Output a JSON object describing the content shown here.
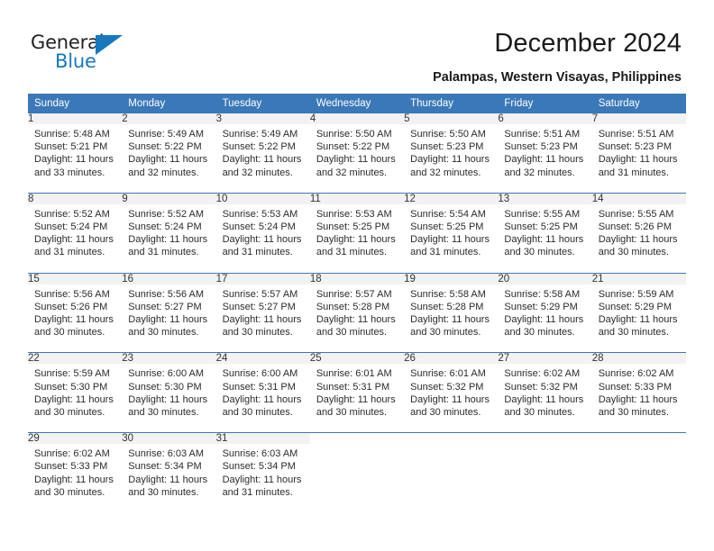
{
  "brand": {
    "name_part1": "General",
    "name_part2": "Blue",
    "accent_color": "#1878be"
  },
  "header": {
    "title": "December 2024",
    "location": "Palampas, Western Visayas, Philippines"
  },
  "theme": {
    "header_blue": "#3b78b8",
    "daynum_background": "#f2f2f2",
    "text_color": "#2b2b2b"
  },
  "weekday_headers": [
    "Sunday",
    "Monday",
    "Tuesday",
    "Wednesday",
    "Thursday",
    "Friday",
    "Saturday"
  ],
  "weeks": [
    {
      "days": [
        {
          "num": "1",
          "sunrise": "Sunrise: 5:48 AM",
          "sunset": "Sunset: 5:21 PM",
          "daylight1": "Daylight: 11 hours",
          "daylight2": "and 33 minutes."
        },
        {
          "num": "2",
          "sunrise": "Sunrise: 5:49 AM",
          "sunset": "Sunset: 5:22 PM",
          "daylight1": "Daylight: 11 hours",
          "daylight2": "and 32 minutes."
        },
        {
          "num": "3",
          "sunrise": "Sunrise: 5:49 AM",
          "sunset": "Sunset: 5:22 PM",
          "daylight1": "Daylight: 11 hours",
          "daylight2": "and 32 minutes."
        },
        {
          "num": "4",
          "sunrise": "Sunrise: 5:50 AM",
          "sunset": "Sunset: 5:22 PM",
          "daylight1": "Daylight: 11 hours",
          "daylight2": "and 32 minutes."
        },
        {
          "num": "5",
          "sunrise": "Sunrise: 5:50 AM",
          "sunset": "Sunset: 5:23 PM",
          "daylight1": "Daylight: 11 hours",
          "daylight2": "and 32 minutes."
        },
        {
          "num": "6",
          "sunrise": "Sunrise: 5:51 AM",
          "sunset": "Sunset: 5:23 PM",
          "daylight1": "Daylight: 11 hours",
          "daylight2": "and 32 minutes."
        },
        {
          "num": "7",
          "sunrise": "Sunrise: 5:51 AM",
          "sunset": "Sunset: 5:23 PM",
          "daylight1": "Daylight: 11 hours",
          "daylight2": "and 31 minutes."
        }
      ]
    },
    {
      "days": [
        {
          "num": "8",
          "sunrise": "Sunrise: 5:52 AM",
          "sunset": "Sunset: 5:24 PM",
          "daylight1": "Daylight: 11 hours",
          "daylight2": "and 31 minutes."
        },
        {
          "num": "9",
          "sunrise": "Sunrise: 5:52 AM",
          "sunset": "Sunset: 5:24 PM",
          "daylight1": "Daylight: 11 hours",
          "daylight2": "and 31 minutes."
        },
        {
          "num": "10",
          "sunrise": "Sunrise: 5:53 AM",
          "sunset": "Sunset: 5:24 PM",
          "daylight1": "Daylight: 11 hours",
          "daylight2": "and 31 minutes."
        },
        {
          "num": "11",
          "sunrise": "Sunrise: 5:53 AM",
          "sunset": "Sunset: 5:25 PM",
          "daylight1": "Daylight: 11 hours",
          "daylight2": "and 31 minutes."
        },
        {
          "num": "12",
          "sunrise": "Sunrise: 5:54 AM",
          "sunset": "Sunset: 5:25 PM",
          "daylight1": "Daylight: 11 hours",
          "daylight2": "and 31 minutes."
        },
        {
          "num": "13",
          "sunrise": "Sunrise: 5:55 AM",
          "sunset": "Sunset: 5:25 PM",
          "daylight1": "Daylight: 11 hours",
          "daylight2": "and 30 minutes."
        },
        {
          "num": "14",
          "sunrise": "Sunrise: 5:55 AM",
          "sunset": "Sunset: 5:26 PM",
          "daylight1": "Daylight: 11 hours",
          "daylight2": "and 30 minutes."
        }
      ]
    },
    {
      "days": [
        {
          "num": "15",
          "sunrise": "Sunrise: 5:56 AM",
          "sunset": "Sunset: 5:26 PM",
          "daylight1": "Daylight: 11 hours",
          "daylight2": "and 30 minutes."
        },
        {
          "num": "16",
          "sunrise": "Sunrise: 5:56 AM",
          "sunset": "Sunset: 5:27 PM",
          "daylight1": "Daylight: 11 hours",
          "daylight2": "and 30 minutes."
        },
        {
          "num": "17",
          "sunrise": "Sunrise: 5:57 AM",
          "sunset": "Sunset: 5:27 PM",
          "daylight1": "Daylight: 11 hours",
          "daylight2": "and 30 minutes."
        },
        {
          "num": "18",
          "sunrise": "Sunrise: 5:57 AM",
          "sunset": "Sunset: 5:28 PM",
          "daylight1": "Daylight: 11 hours",
          "daylight2": "and 30 minutes."
        },
        {
          "num": "19",
          "sunrise": "Sunrise: 5:58 AM",
          "sunset": "Sunset: 5:28 PM",
          "daylight1": "Daylight: 11 hours",
          "daylight2": "and 30 minutes."
        },
        {
          "num": "20",
          "sunrise": "Sunrise: 5:58 AM",
          "sunset": "Sunset: 5:29 PM",
          "daylight1": "Daylight: 11 hours",
          "daylight2": "and 30 minutes."
        },
        {
          "num": "21",
          "sunrise": "Sunrise: 5:59 AM",
          "sunset": "Sunset: 5:29 PM",
          "daylight1": "Daylight: 11 hours",
          "daylight2": "and 30 minutes."
        }
      ]
    },
    {
      "days": [
        {
          "num": "22",
          "sunrise": "Sunrise: 5:59 AM",
          "sunset": "Sunset: 5:30 PM",
          "daylight1": "Daylight: 11 hours",
          "daylight2": "and 30 minutes."
        },
        {
          "num": "23",
          "sunrise": "Sunrise: 6:00 AM",
          "sunset": "Sunset: 5:30 PM",
          "daylight1": "Daylight: 11 hours",
          "daylight2": "and 30 minutes."
        },
        {
          "num": "24",
          "sunrise": "Sunrise: 6:00 AM",
          "sunset": "Sunset: 5:31 PM",
          "daylight1": "Daylight: 11 hours",
          "daylight2": "and 30 minutes."
        },
        {
          "num": "25",
          "sunrise": "Sunrise: 6:01 AM",
          "sunset": "Sunset: 5:31 PM",
          "daylight1": "Daylight: 11 hours",
          "daylight2": "and 30 minutes."
        },
        {
          "num": "26",
          "sunrise": "Sunrise: 6:01 AM",
          "sunset": "Sunset: 5:32 PM",
          "daylight1": "Daylight: 11 hours",
          "daylight2": "and 30 minutes."
        },
        {
          "num": "27",
          "sunrise": "Sunrise: 6:02 AM",
          "sunset": "Sunset: 5:32 PM",
          "daylight1": "Daylight: 11 hours",
          "daylight2": "and 30 minutes."
        },
        {
          "num": "28",
          "sunrise": "Sunrise: 6:02 AM",
          "sunset": "Sunset: 5:33 PM",
          "daylight1": "Daylight: 11 hours",
          "daylight2": "and 30 minutes."
        }
      ]
    },
    {
      "days": [
        {
          "num": "29",
          "sunrise": "Sunrise: 6:02 AM",
          "sunset": "Sunset: 5:33 PM",
          "daylight1": "Daylight: 11 hours",
          "daylight2": "and 30 minutes."
        },
        {
          "num": "30",
          "sunrise": "Sunrise: 6:03 AM",
          "sunset": "Sunset: 5:34 PM",
          "daylight1": "Daylight: 11 hours",
          "daylight2": "and 30 minutes."
        },
        {
          "num": "31",
          "sunrise": "Sunrise: 6:03 AM",
          "sunset": "Sunset: 5:34 PM",
          "daylight1": "Daylight: 11 hours",
          "daylight2": "and 31 minutes."
        },
        {
          "num": "",
          "sunrise": "",
          "sunset": "",
          "daylight1": "",
          "daylight2": ""
        },
        {
          "num": "",
          "sunrise": "",
          "sunset": "",
          "daylight1": "",
          "daylight2": ""
        },
        {
          "num": "",
          "sunrise": "",
          "sunset": "",
          "daylight1": "",
          "daylight2": ""
        },
        {
          "num": "",
          "sunrise": "",
          "sunset": "",
          "daylight1": "",
          "daylight2": ""
        }
      ]
    }
  ]
}
